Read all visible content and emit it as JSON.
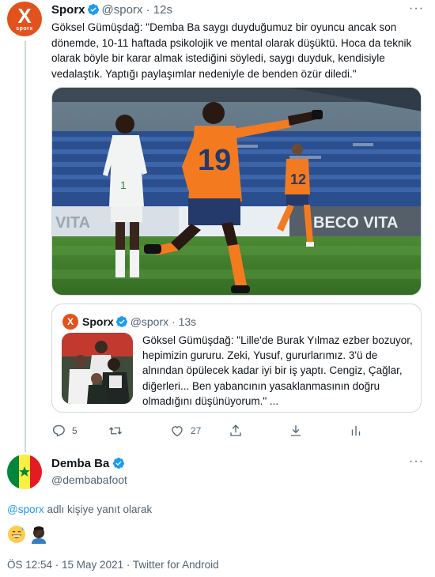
{
  "tweet": {
    "author_name": "Sporx",
    "author_handle": "@sporx",
    "time": "12s",
    "avatar_text": "X",
    "avatar_brand": "sporx",
    "text": "Göksel Gümüşdağ: \"Demba Ba saygı duyduğumuz bir oyuncu ancak son dönemde, 10-11 haftada psikolojik ve mental olarak düşüktü. Hoca da teknik olarak böyle bir karar almak istediğini söyledi, saygı duyduk, kendisiyle vedalaştık. Yaptığı paylaşımlar nedeniyle de benden özür diledi.\"",
    "photo": {
      "ad_left": "VITA",
      "ad_right": "BECO VITA",
      "player_number": "19",
      "back_player_number": "12",
      "opponent_number": "1"
    },
    "quote": {
      "author_name": "Sporx",
      "author_handle": "@sporx",
      "time": "13s",
      "avatar_text": "X",
      "text": "Göksel Gümüşdağ: \"Lille'de Burak Yılmaz ezber bozuyor, hepimizin gururu. Zeki, Yusuf, gururlarımız. 3'ü de alnından öpülecek kadar iyi bir iş yaptı. Cengiz, Çağlar, diğerleri... Ben yabancının yasaklanmasının doğru olmadığını düşünüyorum.\"  ..."
    },
    "actions": {
      "replies": "5",
      "retweets": "",
      "likes": "27"
    }
  },
  "reply": {
    "author_name": "Demba Ba",
    "author_handle": "@dembabafoot",
    "reply_to_handle": "@sporx",
    "reply_to_suffix": " adlı kişiye yanıt olarak",
    "emojis": [
      "grinning-sweat-face",
      "man-facepalming-dark-skin"
    ],
    "timestamp": "ÖS 12:54 · 15 May 2021 · Twitter for Android"
  },
  "colors": {
    "accent": "#1d9bf0",
    "sporx_orange": "#e2521d",
    "muted_text": "#536471",
    "border": "#cfd9de",
    "jersey_orange": "#f47a20",
    "kit_navy": "#243a6b",
    "pitch_green": "#3f7c2e"
  }
}
